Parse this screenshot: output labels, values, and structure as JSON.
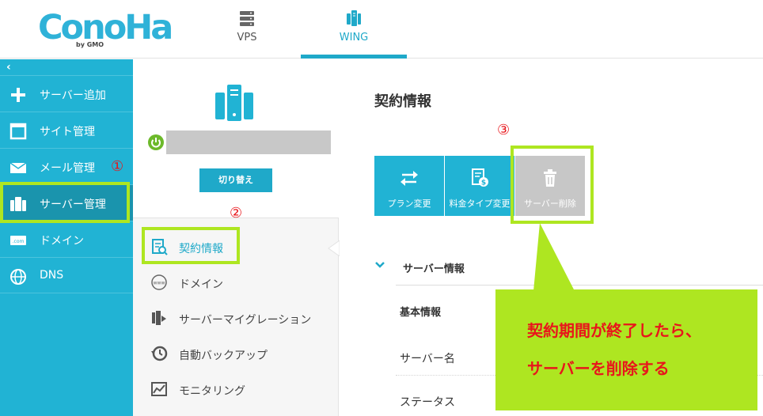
{
  "logo": {
    "text": "ConoHa",
    "sub": "by GMO"
  },
  "nav": {
    "tabs": [
      {
        "label": "VPS",
        "icon": "server-stack-icon"
      },
      {
        "label": "WING",
        "icon": "wing-server-icon",
        "active": true
      }
    ]
  },
  "sidebar": {
    "collapse_label": "‹",
    "items": [
      {
        "label": "サーバー追加",
        "icon": "plus-icon"
      },
      {
        "label": "サイト管理",
        "icon": "window-icon"
      },
      {
        "label": "メール管理",
        "icon": "mail-icon"
      },
      {
        "label": "サーバー管理",
        "icon": "server-icon",
        "active": true
      },
      {
        "label": "ドメイン",
        "icon": "dotcom-icon"
      },
      {
        "label": "DNS",
        "icon": "globe-icon"
      }
    ]
  },
  "server_panel": {
    "switch_label": "切り替え",
    "status_color": "#6cb92a",
    "menu": [
      {
        "label": "契約情報",
        "icon": "contract-icon",
        "active": true
      },
      {
        "label": "ドメイン",
        "icon": "www-icon"
      },
      {
        "label": "サーバーマイグレーション",
        "icon": "migration-icon"
      },
      {
        "label": "自動バックアップ",
        "icon": "backup-icon"
      },
      {
        "label": "モニタリング",
        "icon": "monitoring-icon"
      }
    ]
  },
  "main": {
    "title": "契約情報",
    "actions": [
      {
        "label": "プラン変更",
        "icon": "swap-icon"
      },
      {
        "label": "料金タイプ変更",
        "icon": "billing-icon"
      },
      {
        "label": "サーバー削除",
        "icon": "trash-icon",
        "disabled": true
      }
    ],
    "section_title": "サーバー情報",
    "rows": [
      "基本情報",
      "サーバー名",
      "ステータス"
    ]
  },
  "annotations": {
    "step1": "①",
    "step2": "②",
    "step3": "③",
    "callout_line1": "契約期間が終了したら、",
    "callout_line2": "サーバーを削除する"
  },
  "colors": {
    "brand": "#21b3d4",
    "highlight": "#aee621",
    "annotation": "#e8161b"
  }
}
